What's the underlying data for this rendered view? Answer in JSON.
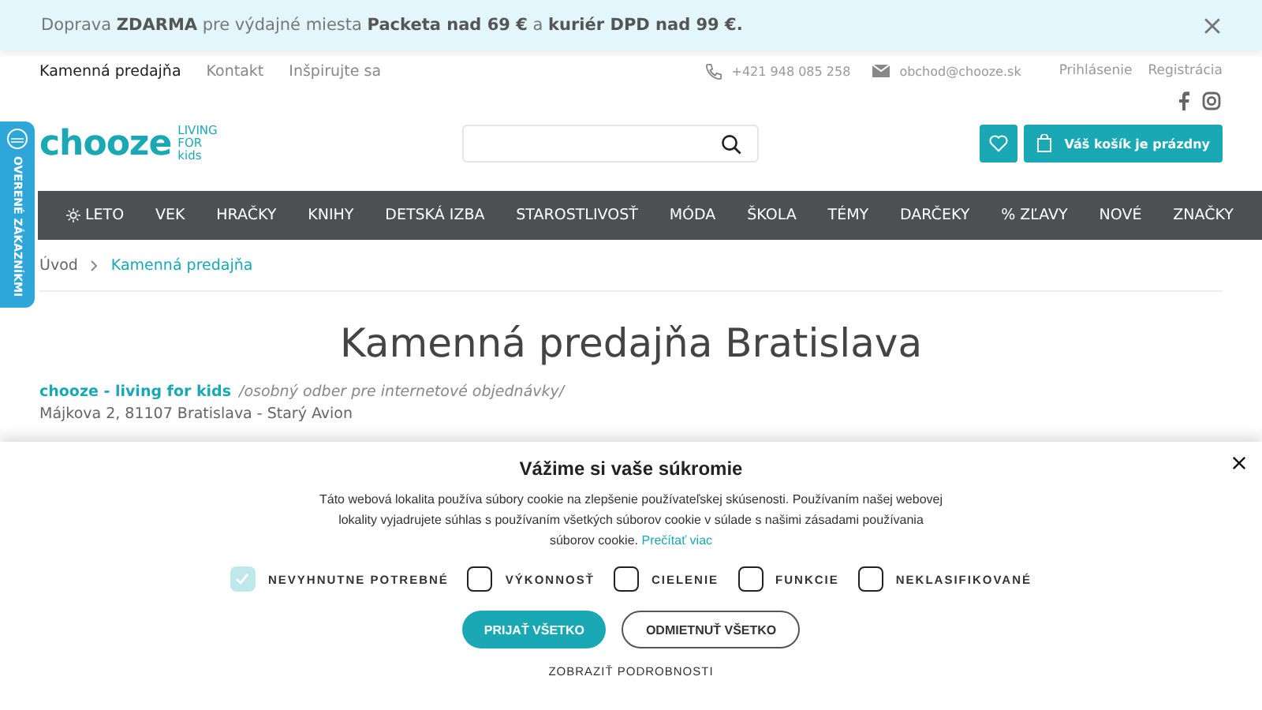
{
  "promo_bar": {
    "text": "Doprava **ZDARMA** pre výdajné miesta **Packeta nad 69 €** a **kuriér DPD nad 99 €.**"
  },
  "top_links": [
    {
      "label": "Kamenná predajňa",
      "selected": true
    },
    {
      "label": "Kontakt",
      "selected": false
    },
    {
      "label": "Inšpirujte sa",
      "selected": false
    }
  ],
  "contact": {
    "phone": "+421 948 085 258",
    "email": "obchod@chooze.sk"
  },
  "account_links": [
    "Prihlásenie",
    "Registrácia"
  ],
  "logo": {
    "name": "chooze",
    "tagline": [
      "LIVING",
      "FOR",
      "kids"
    ]
  },
  "cart": {
    "label": "Váš košík je prázdny"
  },
  "side_tab": {
    "label": "OVERENÉ ZÁKAZNÍKMI"
  },
  "nav": [
    "LETO",
    "VEK",
    "HRAČKY",
    "KNIHY",
    "DETSKÁ IZBA",
    "STAROSTLIVOSŤ",
    "MÓDA",
    "ŠKOLA",
    "TÉMY",
    "DARČEKY",
    "% ZĽAVY",
    "NOVÉ",
    "ZNAČKY"
  ],
  "breadcrumb": [
    "Úvod",
    "Kamenná predajňa"
  ],
  "page": {
    "title": "Kamenná predajňa Bratislava",
    "store_name": "chooze - living for kids",
    "store_note": "/osobný odber pre internetové objednávky/",
    "address": "Májkova 2, 81107 Bratislava - Starý Avion"
  },
  "cookie_dialog": {
    "title": "Vážime si vaše súkromie",
    "text": "Táto webová lokalita používa súbory cookie na zlepšenie používateľskej skúsenosti. Používaním našej webovej lokality vyjadrujete súhlas s používaním všetkých súborov cookie v súlade s našimi zásadami používania súborov cookie.",
    "link": "Prečítať viac",
    "options": [
      {
        "label": "NEVYHNUTNE POTREBNÉ",
        "checked": true,
        "disabled": true
      },
      {
        "label": "VÝKONNOSŤ",
        "checked": false,
        "disabled": false
      },
      {
        "label": "CIELENIE",
        "checked": false,
        "disabled": false
      },
      {
        "label": "FUNKCIE",
        "checked": false,
        "disabled": false
      },
      {
        "label": "NEKLASIFIKOVANÉ",
        "checked": false,
        "disabled": false
      }
    ],
    "accept": "PRIJAŤ VŠETKO",
    "reject": "ODMIETNUŤ VŠETKO",
    "details": "ZOBRAZIŤ PODROBNOSTI"
  }
}
